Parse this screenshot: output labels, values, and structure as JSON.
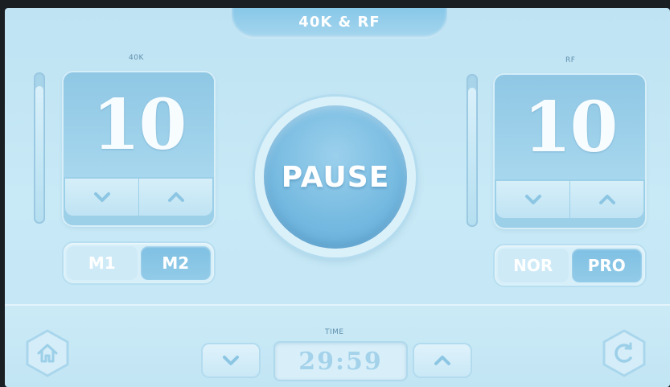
{
  "header": {
    "title": "40K & RF"
  },
  "left": {
    "label": "40K",
    "value": "10",
    "level": 0.92,
    "modes": [
      "M1",
      "M2"
    ],
    "active_mode": "M2"
  },
  "right": {
    "label": "RF",
    "value": "10",
    "level": 0.92,
    "modes": [
      "NOR",
      "PRO"
    ],
    "active_mode": "PRO"
  },
  "center": {
    "pause_label": "PAUSE"
  },
  "footer": {
    "time_label": "TIME",
    "time_value": "29:59"
  },
  "colors": {
    "background": "#c3e6f5",
    "accent": "#74b9e0",
    "panel": "#9ccfe8",
    "text_light": "#ffffff",
    "label": "#5f90ad"
  },
  "icons": {
    "home": "home-icon",
    "reset": "refresh-icon",
    "down": "chevron-down-icon",
    "up": "chevron-up-icon"
  }
}
